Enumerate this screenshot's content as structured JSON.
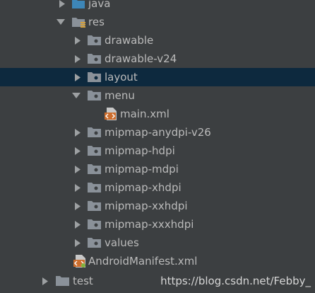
{
  "tree": {
    "java": "java",
    "res": "res",
    "drawable": "drawable",
    "drawable_v24": "drawable-v24",
    "layout": "layout",
    "menu": "menu",
    "main_xml": "main.xml",
    "mipmap_anydpi_v26": "mipmap-anydpi-v26",
    "mipmap_hdpi": "mipmap-hdpi",
    "mipmap_mdpi": "mipmap-mdpi",
    "mipmap_xhdpi": "mipmap-xhdpi",
    "mipmap_xxhdpi": "mipmap-xxhdpi",
    "mipmap_xxxhdpi": "mipmap-xxxhdpi",
    "values": "values",
    "manifest": "AndroidManifest.xml",
    "test": "test"
  },
  "selected_item": "layout",
  "watermark": "https://blog.csdn.net/Febby_",
  "colors": {
    "background": "#3c3f41",
    "selection": "#0d293e",
    "text": "#bbbbbb",
    "folder": "#8a9199",
    "source_folder": "#3d86b8",
    "xml_icon": "#cc6d2d"
  }
}
